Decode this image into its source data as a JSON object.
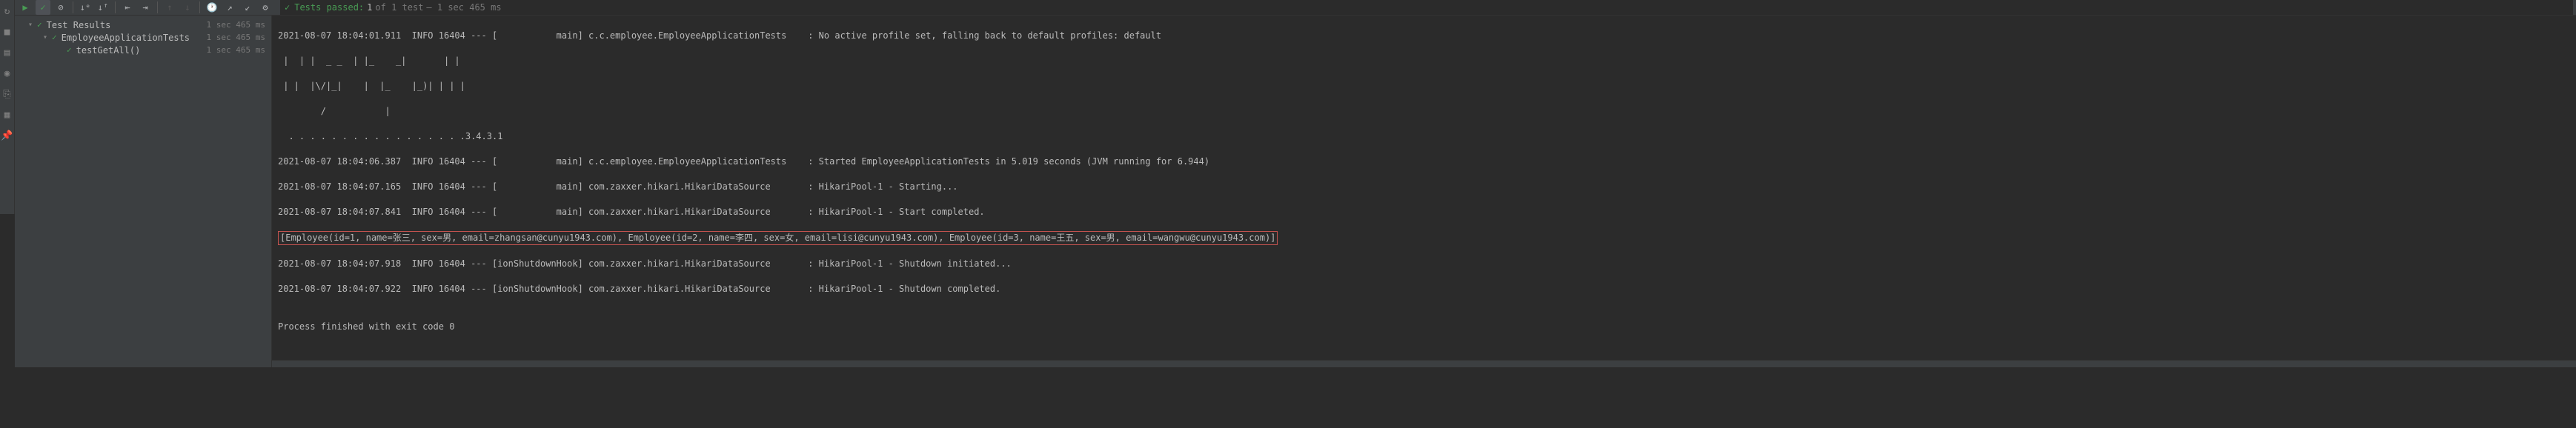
{
  "toolbar": {
    "run": "▶",
    "check": "✓",
    "stop": "⊘"
  },
  "test_header": {
    "prefix": "Tests passed:",
    "count": "1",
    "of": "of 1 test",
    "time": "– 1 sec 465 ms"
  },
  "tree": {
    "root": {
      "label": "Test Results",
      "time": "1 sec  465 ms"
    },
    "suite": {
      "label": "EmployeeApplicationTests",
      "time": "1 sec  465 ms"
    },
    "test": {
      "label": "testGetAll()",
      "time": "1 sec  465 ms"
    }
  },
  "console": {
    "lines": [
      "2021-08-07 18:04:01.911  INFO 16404 --- [           main] c.c.employee.EmployeeApplicationTests    : No active profile set, falling back to default profiles: default",
      " |  | |  _ _  | |_    _|       | |",
      " | |  |\\/|_|    |  |_    |_)| | | |",
      "        /           |",
      "  . . . . . . . . . . . . . . . . .3.4.3.1",
      "2021-08-07 18:04:06.387  INFO 16404 --- [           main] c.c.employee.EmployeeApplicationTests    : Started EmployeeApplicationTests in 5.019 seconds (JVM running for 6.944)",
      "2021-08-07 18:04:07.165  INFO 16404 --- [           main] com.zaxxer.hikari.HikariDataSource       : HikariPool-1 - Starting...",
      "2021-08-07 18:04:07.841  INFO 16404 --- [           main] com.zaxxer.hikari.HikariDataSource       : HikariPool-1 - Start completed."
    ],
    "highlighted": "[Employee(id=1, name=张三, sex=男, email=zhangsan@cunyu1943.com), Employee(id=2, name=李四, sex=女, email=lisi@cunyu1943.com), Employee(id=3, name=王五, sex=男, email=wangwu@cunyu1943.com)]",
    "lines_after": [
      "2021-08-07 18:04:07.918  INFO 16404 --- [ionShutdownHook] com.zaxxer.hikari.HikariDataSource       : HikariPool-1 - Shutdown initiated...",
      "2021-08-07 18:04:07.922  INFO 16404 --- [ionShutdownHook] com.zaxxer.hikari.HikariDataSource       : HikariPool-1 - Shutdown completed.",
      "",
      "Process finished with exit code 0"
    ]
  }
}
